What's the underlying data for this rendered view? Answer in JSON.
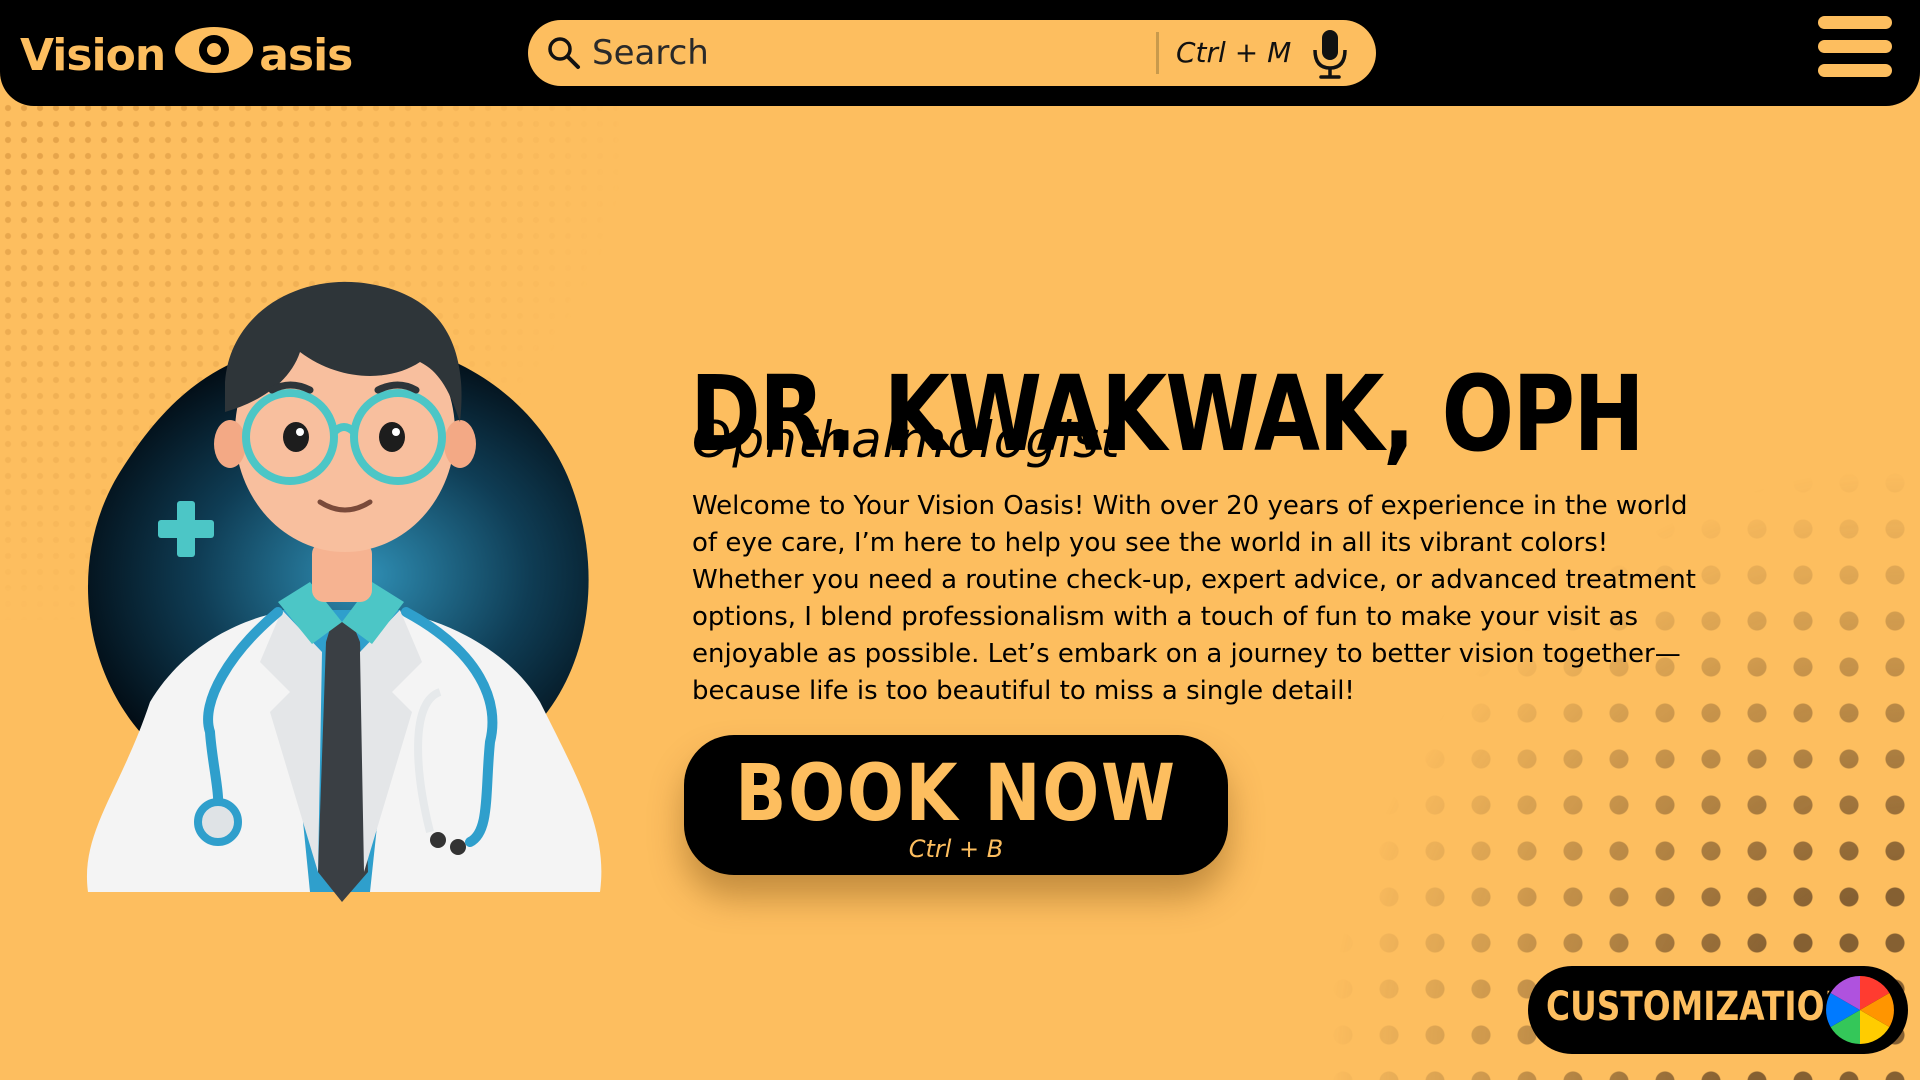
{
  "header": {
    "logo": {
      "part1": "Vision",
      "part2": "asis"
    },
    "search": {
      "placeholder": "Search",
      "shortcut": "Ctrl + M"
    },
    "icons": {
      "search": "search-icon",
      "mic": "microphone-icon",
      "menu": "hamburger-menu-icon"
    }
  },
  "profile": {
    "name": "DR. KWAKWAK, OPH",
    "title": "Ophthalmologist",
    "bio": "Welcome to Your Vision Oasis! With over 20 years of experience in the world of eye care, I’m here to help you see the world in all its vibrant colors! Whether you need a routine check-up, expert advice, or advanced treatment options, I blend professionalism with a touch of fun to make your visit as enjoyable as possible. Let’s embark on a journey to better vision together—because life is too beautiful to miss a single detail!"
  },
  "book": {
    "label": "BOOK NOW",
    "shortcut": "Ctrl + B"
  },
  "customization": {
    "label": "CUSTOMIZATION",
    "icon": "color-wheel-icon"
  },
  "colors": {
    "accent": "#fdbe5f",
    "dark": "#000000",
    "teal": "#4cc6c6"
  }
}
